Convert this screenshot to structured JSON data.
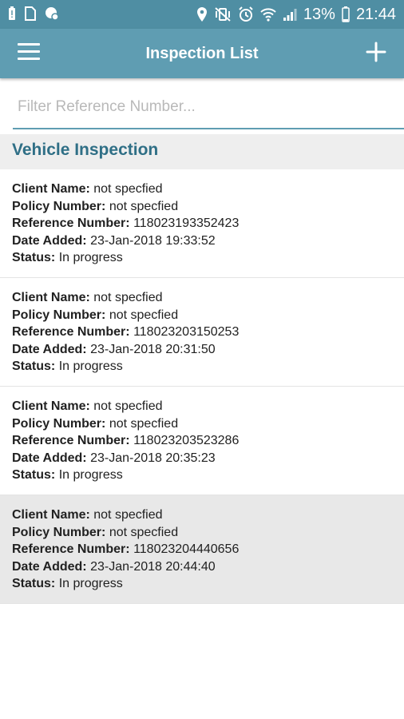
{
  "status_bar": {
    "battery": "13%",
    "time": "21:44"
  },
  "app_bar": {
    "title": "Inspection List"
  },
  "filter": {
    "placeholder": "Filter Reference Number..."
  },
  "section": {
    "title": "Vehicle Inspection"
  },
  "labels": {
    "client_name": "Client Name:",
    "policy_number": "Policy Number:",
    "reference_number": "Reference Number:",
    "date_added": "Date Added:",
    "status": "Status:"
  },
  "inspections": [
    {
      "client_name": "not specfied",
      "policy_number": "not specfied",
      "reference_number": "118023193352423",
      "date_added": "23-Jan-2018 19:33:52",
      "status": "In progress"
    },
    {
      "client_name": "not specfied",
      "policy_number": "not specfied",
      "reference_number": "118023203150253",
      "date_added": "23-Jan-2018 20:31:50",
      "status": "In progress"
    },
    {
      "client_name": "not specfied",
      "policy_number": "not specfied",
      "reference_number": "118023203523286",
      "date_added": "23-Jan-2018 20:35:23",
      "status": "In progress"
    },
    {
      "client_name": "not specfied",
      "policy_number": "not specfied",
      "reference_number": "118023204440656",
      "date_added": "23-Jan-2018 20:44:40",
      "status": "In progress"
    }
  ]
}
